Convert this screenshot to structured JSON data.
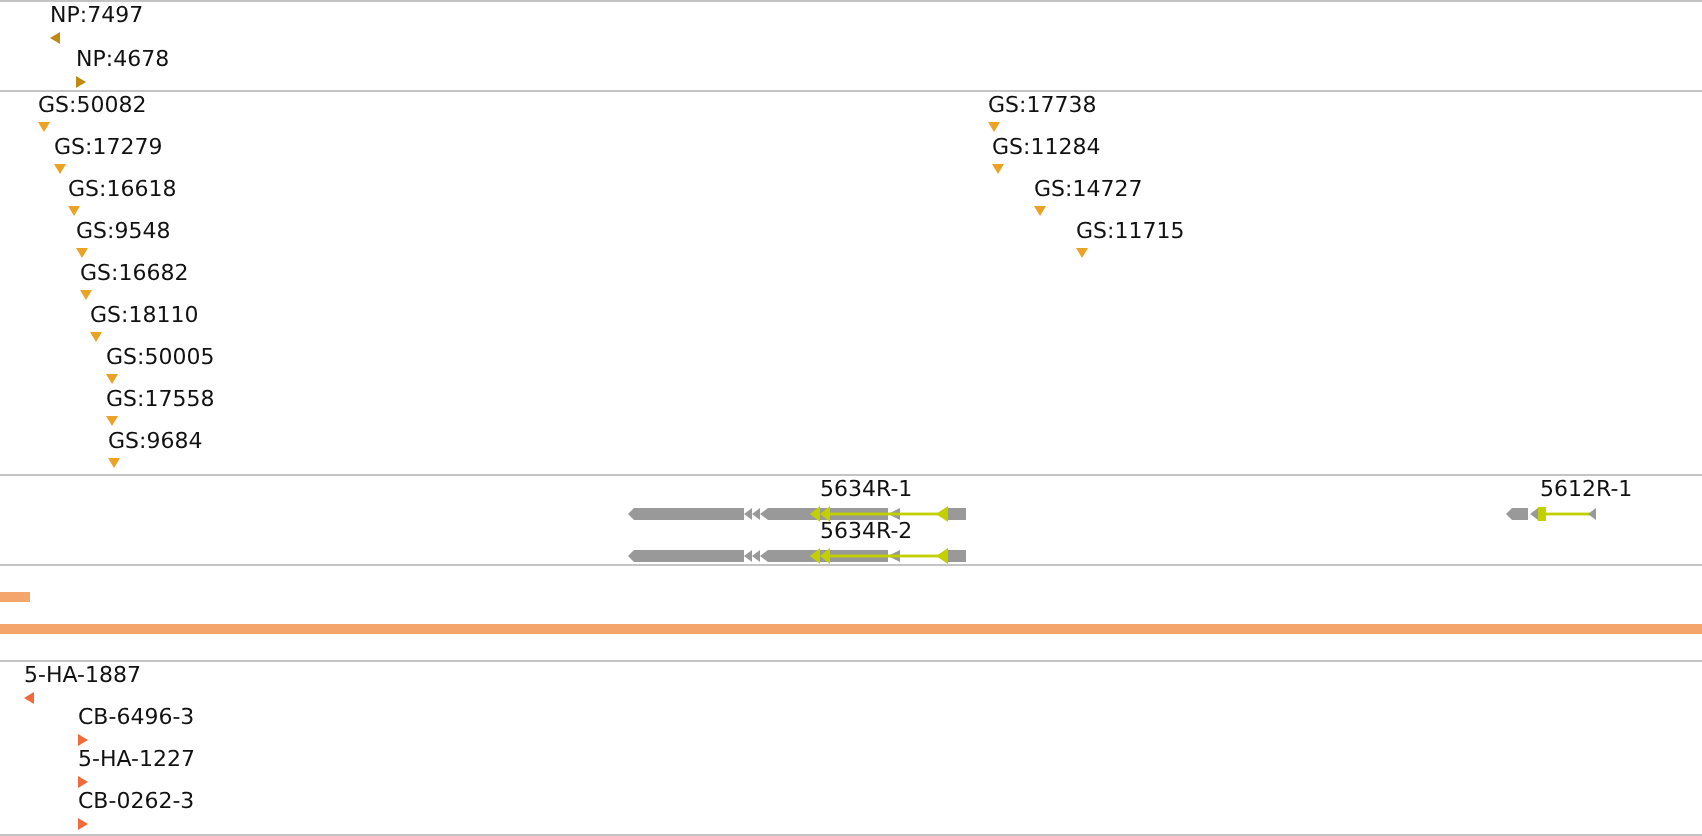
{
  "tracks": [
    {
      "kind": "features",
      "color": "#c08a12",
      "features": [
        {
          "label": "NP:7497",
          "kind": "left"
        },
        {
          "label": "NP:4678",
          "kind": "right"
        }
      ]
    },
    {
      "kind": "features",
      "color": "#eba325",
      "features": [
        {
          "label": "GS:50082",
          "kind": "down"
        },
        {
          "label": "GS:17279",
          "kind": "down"
        },
        {
          "label": "GS:16618",
          "kind": "down"
        },
        {
          "label": "GS:9548",
          "kind": "down"
        },
        {
          "label": "GS:16682",
          "kind": "down"
        },
        {
          "label": "GS:18110",
          "kind": "down"
        },
        {
          "label": "GS:50005",
          "kind": "down"
        },
        {
          "label": "GS:17558",
          "kind": "down"
        },
        {
          "label": "GS:9684",
          "kind": "down"
        },
        {
          "label": "GS:17738",
          "kind": "down"
        },
        {
          "label": "GS:11284",
          "kind": "down"
        },
        {
          "label": "GS:14727",
          "kind": "down"
        },
        {
          "label": "GS:11715",
          "kind": "down"
        }
      ]
    },
    {
      "kind": "genes",
      "genes": [
        {
          "label": "5634R-1"
        },
        {
          "label": "5634R-2"
        },
        {
          "label": "5612R-1"
        }
      ]
    },
    {
      "kind": "coverage",
      "color": "#f4a56c"
    },
    {
      "kind": "features",
      "color": "#f06a3c",
      "features": [
        {
          "label": "5-HA-1887",
          "kind": "left"
        },
        {
          "label": "CB-6496-3",
          "kind": "right"
        },
        {
          "label": "5-HA-1227",
          "kind": "right"
        },
        {
          "label": "CB-0262-3",
          "kind": "right"
        }
      ]
    }
  ]
}
